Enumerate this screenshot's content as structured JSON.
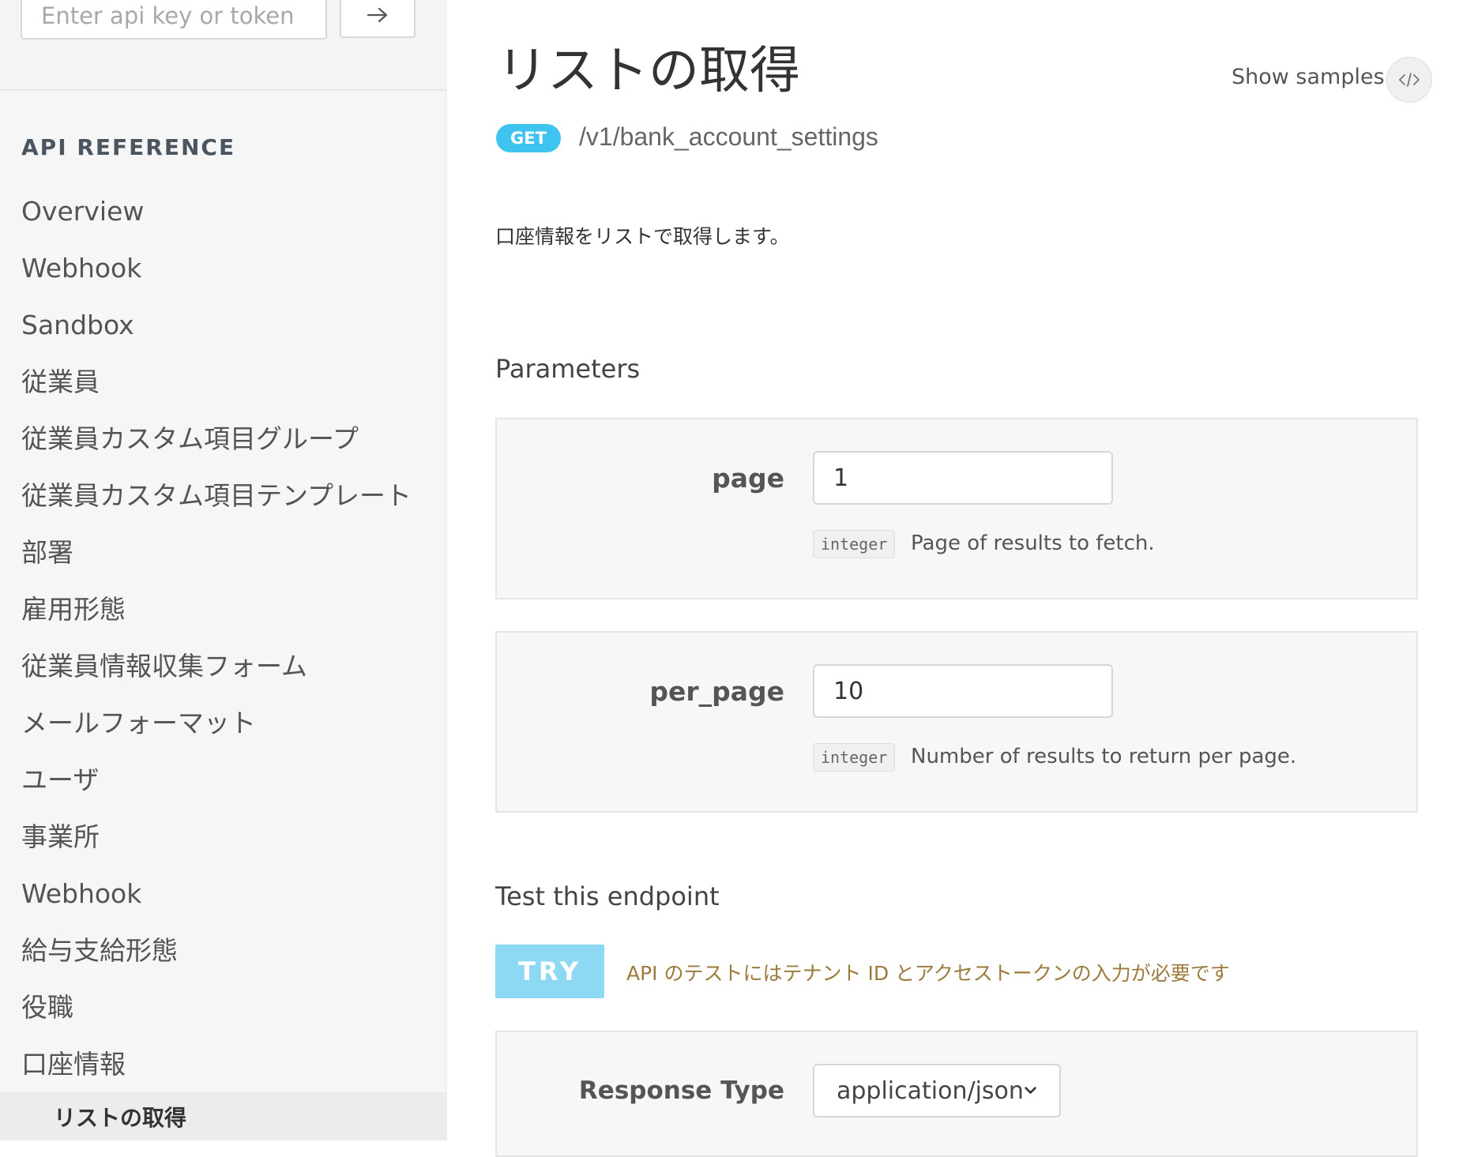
{
  "sidebar": {
    "api_key_placeholder": "Enter api key or token",
    "heading": "API REFERENCE",
    "items": [
      {
        "label": "Overview"
      },
      {
        "label": "Webhook"
      },
      {
        "label": "Sandbox"
      },
      {
        "label": "従業員"
      },
      {
        "label": "従業員カスタム項目グループ"
      },
      {
        "label": "従業員カスタム項目テンプレート"
      },
      {
        "label": "部署"
      },
      {
        "label": "雇用形態"
      },
      {
        "label": "従業員情報収集フォーム"
      },
      {
        "label": "メールフォーマット"
      },
      {
        "label": "ユーザ"
      },
      {
        "label": "事業所"
      },
      {
        "label": "Webhook"
      },
      {
        "label": "給与支給形態"
      },
      {
        "label": "役職"
      },
      {
        "label": "口座情報"
      }
    ],
    "active_subitem": "リストの取得"
  },
  "main": {
    "title": "リストの取得",
    "show_samples_label": "Show samples",
    "method": "GET",
    "path": "/v1/bank_account_settings",
    "description": "口座情報をリストで取得します。",
    "parameters_title": "Parameters",
    "params": [
      {
        "name": "page",
        "value": "1",
        "type": "integer",
        "description": "Page of results to fetch."
      },
      {
        "name": "per_page",
        "value": "10",
        "type": "integer",
        "description": "Number of results to return per page."
      }
    ],
    "test_title": "Test this endpoint",
    "try_label": "TRY",
    "try_note": "API のテストにはテナント ID とアクセストークンの入力が必要です",
    "response_type_label": "Response Type",
    "response_type_value": "application/json"
  },
  "colors": {
    "accent": "#3fc4f0",
    "try_button": "#8dd9f3",
    "note_text": "#9b7a3c"
  },
  "icons": [
    "arrow-right-icon",
    "code-icon",
    "chevron-down-icon"
  ]
}
